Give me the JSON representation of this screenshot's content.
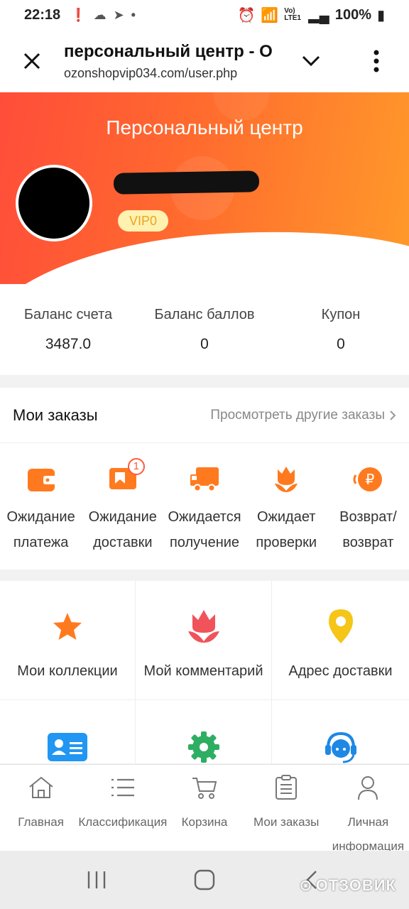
{
  "status_bar": {
    "time": "22:18",
    "battery": "100%",
    "network": "Vo) LTE1"
  },
  "browser": {
    "page_title": "персональный центр - O",
    "url": "ozonshopvip034.com/user.php"
  },
  "hero": {
    "title": "Персональный центр",
    "vip": "VIP0"
  },
  "balance": [
    {
      "label": "Баланс счета",
      "value": "3487.0"
    },
    {
      "label": "Баланс баллов",
      "value": "0"
    },
    {
      "label": "Купон",
      "value": "0"
    }
  ],
  "orders": {
    "title": "Мои заказы",
    "more": "Просмотреть другие заказы",
    "items": [
      {
        "line1": "Ожидание",
        "line2": "платежа",
        "icon": "wallet-icon"
      },
      {
        "line1": "Ожидание",
        "line2": "доставки",
        "icon": "box-icon",
        "badge": "1"
      },
      {
        "line1": "Ожидается",
        "line2": "получение",
        "icon": "truck-icon"
      },
      {
        "line1": "Ожидает",
        "line2": "проверки",
        "icon": "tulip-icon"
      },
      {
        "line1": "Возврат/",
        "line2": "возврат",
        "icon": "refund-icon"
      }
    ]
  },
  "grid": [
    {
      "label": "Мои коллекции",
      "icon": "star-icon"
    },
    {
      "label": "Мой комментарий",
      "icon": "tulip-icon"
    },
    {
      "label": "Адрес доставки",
      "icon": "location-pin-icon"
    },
    {
      "label": "",
      "icon": "id-card-icon"
    },
    {
      "label": "",
      "icon": "gear-icon"
    },
    {
      "label": "",
      "icon": "support-agent-icon"
    }
  ],
  "tabbar": [
    {
      "label": "Главная",
      "icon": "home-icon"
    },
    {
      "label": "Классификация",
      "icon": "list-icon"
    },
    {
      "label": "Корзина",
      "icon": "cart-icon"
    },
    {
      "label": "Мои заказы",
      "icon": "clipboard-icon"
    },
    {
      "label": "Личная информация",
      "icon": "user-icon"
    }
  ],
  "watermark": "ОТЗОВИК",
  "colors": {
    "accent": "#ff5a3c",
    "gradient_start": "#ff4d3a",
    "gradient_end": "#ff9a2a",
    "icon_orange": "#ff7a1f",
    "green": "#2eae62",
    "blue": "#2196f3"
  }
}
